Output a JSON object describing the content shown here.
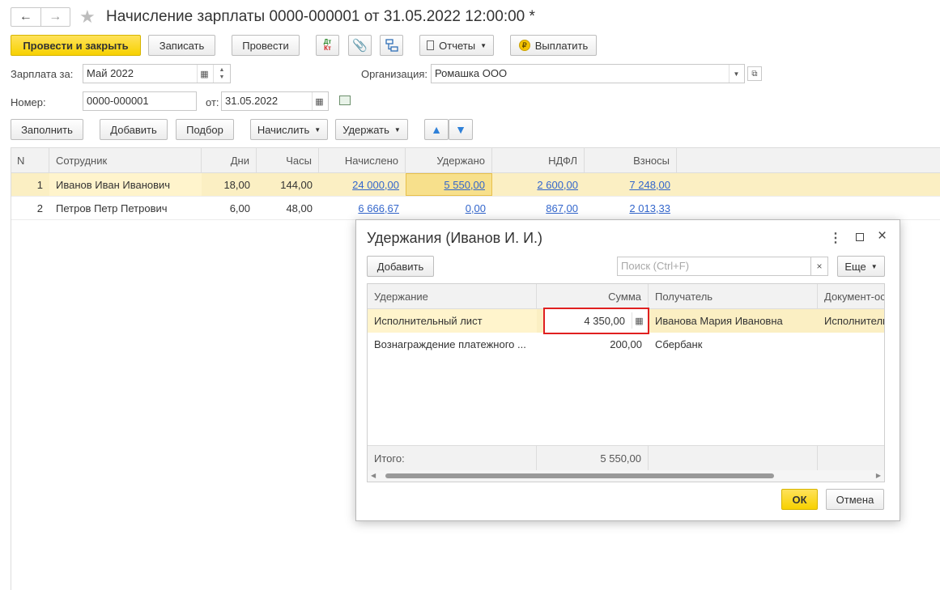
{
  "window": {
    "title": "Начисление зарплаты 0000-000001 от 31.05.2022 12:00:00 *"
  },
  "toolbar": {
    "post_close": "Провести и закрыть",
    "save": "Записать",
    "post": "Провести",
    "dtkt_dt": "Дт",
    "dtkt_kt": "Кт",
    "reports": "Отчеты",
    "pay": "Выплатить"
  },
  "form": {
    "salary_for_label": "Зарплата за:",
    "salary_for_value": "Май 2022",
    "org_label": "Организация:",
    "org_value": "Ромашка ООО",
    "number_label": "Номер:",
    "number_value": "0000-000001",
    "date_label": "от:",
    "date_value": "31.05.2022"
  },
  "table_toolbar": {
    "fill": "Заполнить",
    "add": "Добавить",
    "select": "Подбор",
    "accrue": "Начислить",
    "withhold": "Удержать"
  },
  "main_table": {
    "headers": [
      "N",
      "Сотрудник",
      "Дни",
      "Часы",
      "Начислено",
      "Удержано",
      "НДФЛ",
      "Взносы"
    ],
    "rows": [
      {
        "n": "1",
        "employee": "Иванов Иван Иванович",
        "days": "18,00",
        "hours": "144,00",
        "accrued": "24 000,00",
        "withheld": "5 550,00",
        "ndfl": "2 600,00",
        "contrib": "7 248,00"
      },
      {
        "n": "2",
        "employee": "Петров Петр Петрович",
        "days": "6,00",
        "hours": "48,00",
        "accrued": "6 666,67",
        "withheld": "0,00",
        "ndfl": "867,00",
        "contrib": "2 013,33"
      }
    ]
  },
  "dialog": {
    "title": "Удержания (Иванов И. И.)",
    "add": "Добавить",
    "search_placeholder": "Поиск (Ctrl+F)",
    "more": "Еще",
    "headers": [
      "Удержание",
      "Сумма",
      "Получатель",
      "Документ-ос"
    ],
    "rows": [
      {
        "withholding": "Исполнительный лист",
        "amount": "4 350,00",
        "recipient": "Иванова Мария Ивановна",
        "doc": "Исполнитель"
      },
      {
        "withholding": "Вознаграждение платежного ...",
        "amount": "200,00",
        "recipient": "Сбербанк",
        "doc": ""
      }
    ],
    "total_label": "Итого:",
    "total_value": "5 550,00",
    "ok": "ОК",
    "cancel": "Отмена"
  },
  "colors": {
    "accent_yellow": "#f7d100",
    "selected_row": "#fbefc3",
    "link_blue": "#3366cc",
    "highlight_red": "#e02020"
  }
}
